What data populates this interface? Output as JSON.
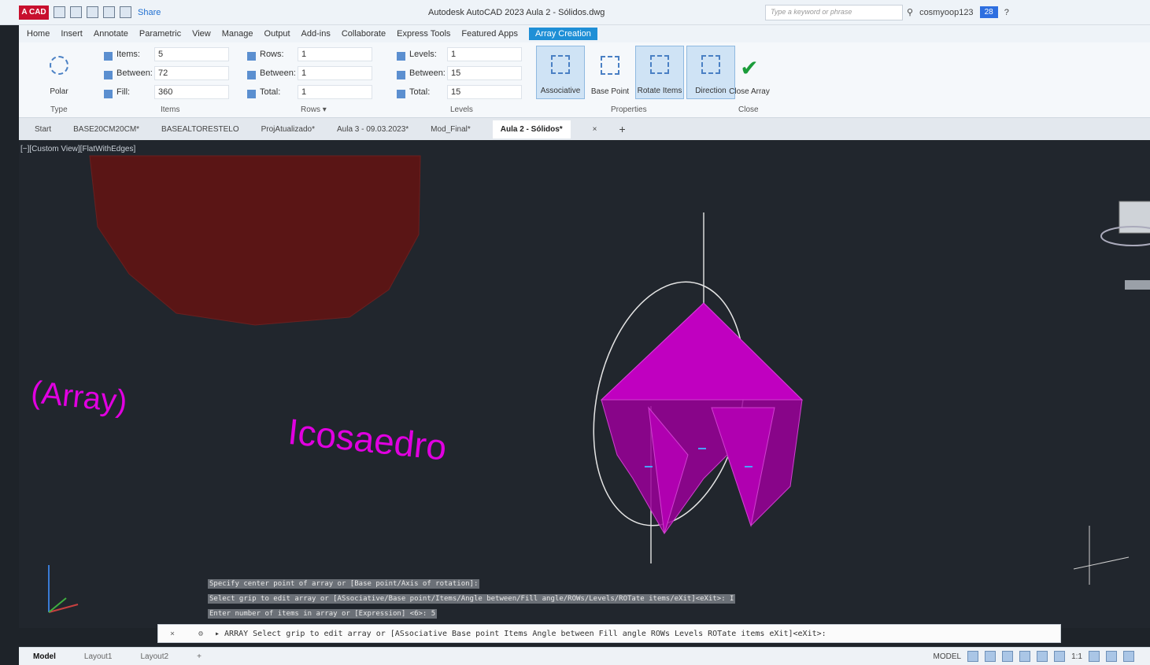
{
  "titlebar": {
    "logo": "A CAD",
    "share": "Share",
    "title": "Autodesk AutoCAD 2023  Aula 2 - Sólidos.dwg",
    "search_placeholder": "Type a keyword or phrase",
    "user": "cosmyoop123",
    "badge": "28"
  },
  "ribbon_tabs": [
    "Home",
    "Insert",
    "Annotate",
    "Parametric",
    "View",
    "Manage",
    "Output",
    "Add-ins",
    "Collaborate",
    "Express Tools",
    "Featured Apps",
    "Array Creation"
  ],
  "ribbon": {
    "type": {
      "title": "Type",
      "polar": "Polar"
    },
    "items": {
      "title": "Items",
      "items_label": "Items:",
      "items_val": "5",
      "between_label": "Between:",
      "between_val": "72",
      "fill_label": "Fill:",
      "fill_val": "360"
    },
    "rows": {
      "title": "Rows ▾",
      "rows_label": "Rows:",
      "rows_val": "1",
      "between_label": "Between:",
      "between_val": "1",
      "total_label": "Total:",
      "total_val": "1"
    },
    "levels": {
      "title": "Levels",
      "levels_label": "Levels:",
      "levels_val": "1",
      "between_label": "Between:",
      "between_val": "15",
      "total_label": "Total:",
      "total_val": "15"
    },
    "properties": {
      "title": "Properties",
      "associative": "Associative",
      "base_point": "Base Point",
      "rotate_items": "Rotate Items",
      "direction": "Direction"
    },
    "close": {
      "title": "Close",
      "label": "Close Array"
    }
  },
  "doc_tabs": [
    "Start",
    "BASE20CM20CM*",
    "BASEALTORESTELO",
    "ProjAtualizado*",
    "Aula 3 - 09.03.2023*",
    "Mod_Final*",
    "Aula 2 - Sólidos*"
  ],
  "viewport": {
    "label": "[−][Custom View][FlatWithEdges]",
    "text_array": "(Array)",
    "text_icosaedro": "Icosaedro",
    "colors": {
      "magenta": "#d000d0",
      "darkred": "#5a1515",
      "bg": "#21262d"
    }
  },
  "command_log": [
    "Specify center point of array or [Base point/Axis of rotation]:",
    "Select grip to edit array or [ASsociative/Base point/Items/Angle between/Fill angle/ROWs/Levels/ROTate items/eXit]<eXit>: I",
    "Enter number of items in array or [Expression] <6>: 5"
  ],
  "command_line": "▸ ARRAY Select grip to edit array or [ASsociative Base point Items Angle between Fill angle ROWs Levels ROTate items eXit]<eXit>:",
  "status": {
    "layouts": [
      "Model",
      "Layout1",
      "Layout2"
    ],
    "model": "MODEL",
    "scale": "1:1"
  }
}
